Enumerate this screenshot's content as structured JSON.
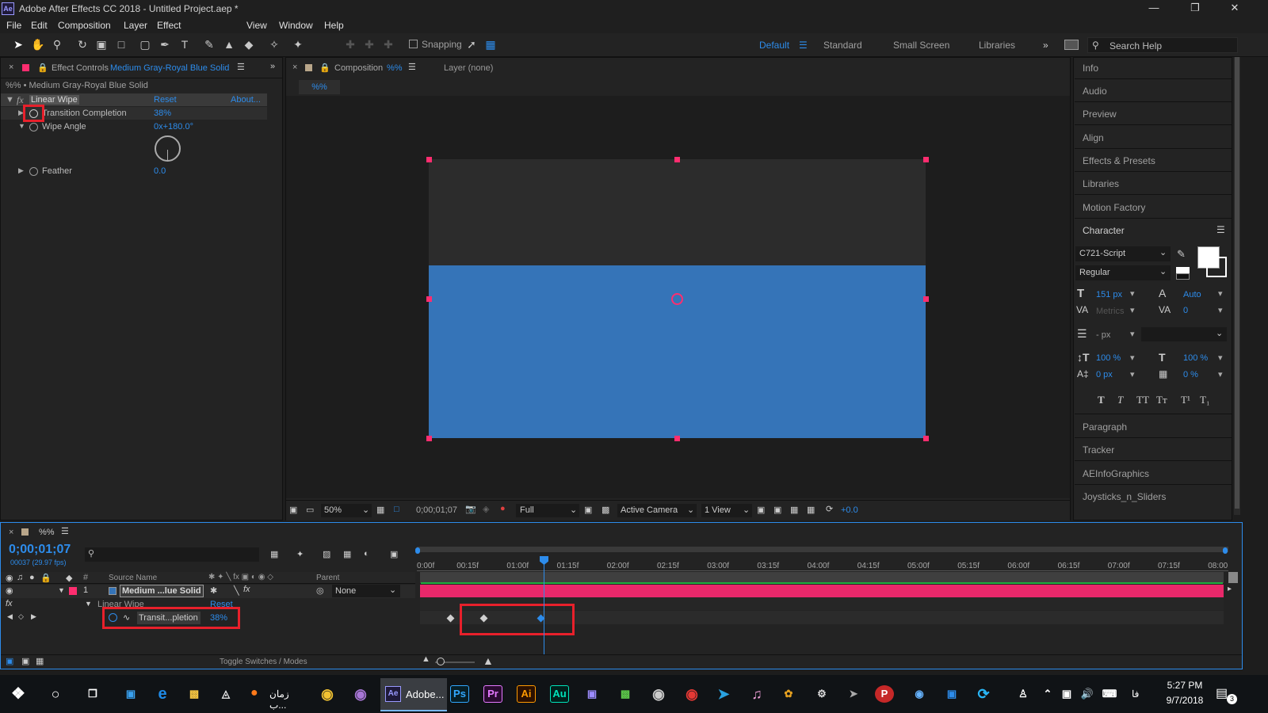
{
  "app": {
    "badge": "Ae",
    "title": "Adobe After Effects CC 2018 - Untitled Project.aep *"
  },
  "menu": [
    "File",
    "Edit",
    "Composition",
    "Layer",
    "Effect",
    "View",
    "Window",
    "Help"
  ],
  "toolbar": {
    "snapping_label": "Snapping"
  },
  "workspaces": {
    "items": [
      "Default",
      "Standard",
      "Small Screen",
      "Libraries"
    ],
    "active": "Default",
    "search_placeholder": "Search Help"
  },
  "effect_controls": {
    "tab_prefix": "Effect Controls",
    "tab_layer": "Medium Gray-Royal Blue Solid",
    "subtitle": "%% • Medium Gray-Royal Blue Solid",
    "effect_name": "Linear Wipe",
    "reset": "Reset",
    "about": "About...",
    "props": [
      {
        "name": "Transition Completion",
        "value": "38%"
      },
      {
        "name": "Wipe Angle",
        "value": "0x+180.0°"
      },
      {
        "name": "Feather",
        "value": "0.0"
      }
    ]
  },
  "composition": {
    "tab_label": "Composition",
    "tab_name": "%%",
    "layer_tab": "Layer (none)",
    "sub_tab": "%%",
    "footer": {
      "zoom": "50%",
      "timecode": "0;00;01;07",
      "resolution": "Full",
      "camera": "Active Camera",
      "views": "1 View",
      "exposure": "+0.0"
    },
    "colors": {
      "top": "#2c2c2c",
      "bottom": "#3574b8"
    }
  },
  "right_panels": {
    "items": [
      "Info",
      "Audio",
      "Preview",
      "Align",
      "Effects & Presets",
      "Libraries",
      "Motion Factory"
    ],
    "character": {
      "title": "Character",
      "font": "C721-Script",
      "style": "Regular",
      "size": "151 px",
      "leading": "Auto",
      "kerning": "Metrics",
      "tracking": "0",
      "stroke": "- px",
      "vscale": "100 %",
      "hscale": "100 %",
      "baseline": "0 px",
      "tsume": "0 %",
      "style_buttons": [
        "T",
        "T",
        "TT",
        "Tт",
        "T¹",
        "T₁"
      ]
    },
    "items_after": [
      "Paragraph",
      "Tracker",
      "AEInfoGraphics",
      "Joysticks_n_Sliders"
    ]
  },
  "timeline": {
    "tab": "%%",
    "timecode": "0;00;01;07",
    "fps": "00037 (29.97 fps)",
    "col_source": "Source Name",
    "col_parent": "Parent",
    "layer": {
      "num": "1",
      "name": "Medium ...lue Solid",
      "parent": "None"
    },
    "effect_row": {
      "name": "Linear Wipe",
      "reset": "Reset"
    },
    "prop_row": {
      "name": "Transit...pletion",
      "value": "38%"
    },
    "ruler": [
      "0:00f",
      "00:15f",
      "01:00f",
      "01:15f",
      "02:00f",
      "02:15f",
      "03:00f",
      "03:15f",
      "04:00f",
      "04:15f",
      "05:00f",
      "05:15f",
      "06:00f",
      "06:15f",
      "07:00f",
      "07:15f",
      "08:00"
    ],
    "keyframe_times": [
      "00:10f",
      "00:20f",
      "01:07f"
    ],
    "toggle_label": "Toggle Switches / Modes"
  },
  "taskbar": {
    "apps": [
      "زمان ب...",
      "Adobe...",
      "Ps",
      "Pr",
      "Ai",
      "Au"
    ],
    "time": "5:27 PM",
    "date": "9/7/2018",
    "lang": "فا",
    "notif": "3"
  }
}
